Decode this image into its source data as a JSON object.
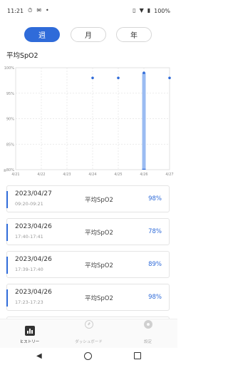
{
  "status_bar": {
    "time": "11:21",
    "battery": "100%",
    "left_icons": [
      "timer-icon",
      "gmail-icon",
      "dot-icon"
    ],
    "right_icons": [
      "vibrate-icon",
      "wifi-icon",
      "battery-icon"
    ]
  },
  "tabs": {
    "week": "週",
    "month": "月",
    "year": "年",
    "selected": "week"
  },
  "section_title": "平均SpO2",
  "chart_data": {
    "type": "scatter",
    "title": "",
    "xlabel": "",
    "ylabel": "",
    "ylim": [
      80,
      100
    ],
    "y_ticks": [
      "100%",
      "95%",
      "90%",
      "85%",
      "≦80%"
    ],
    "categories": [
      "4/21",
      "4/22",
      "4/23",
      "4/24",
      "4/25",
      "4/26",
      "4/27"
    ],
    "points": [
      {
        "x": "4/24",
        "y": 98
      },
      {
        "x": "4/25",
        "y": 98
      },
      {
        "x": "4/26",
        "y": 99
      },
      {
        "x": "4/27",
        "y": 98
      }
    ],
    "range_bars": [
      {
        "x": "4/26",
        "low": 80,
        "high": 99
      }
    ],
    "grid": true,
    "point_color": "#2f6bd9",
    "range_color": "#9bbcf2"
  },
  "records": [
    {
      "date": "2023/04/27",
      "time": "09:20-09:21",
      "label": "平均SpO2",
      "value": "98%"
    },
    {
      "date": "2023/04/26",
      "time": "17:40-17:41",
      "label": "平均SpO2",
      "value": "78%"
    },
    {
      "date": "2023/04/26",
      "time": "17:39-17:40",
      "label": "平均SpO2",
      "value": "89%"
    },
    {
      "date": "2023/04/26",
      "time": "17:23-17:23",
      "label": "平均SpO2",
      "value": "98%"
    }
  ],
  "bottom_nav": {
    "history": "ヒストリー",
    "dashboard": "ダッシュボード",
    "settings": "設定",
    "selected": "history"
  },
  "colors": {
    "accent": "#2f6bd9",
    "card_border": "#e4e4e4"
  }
}
